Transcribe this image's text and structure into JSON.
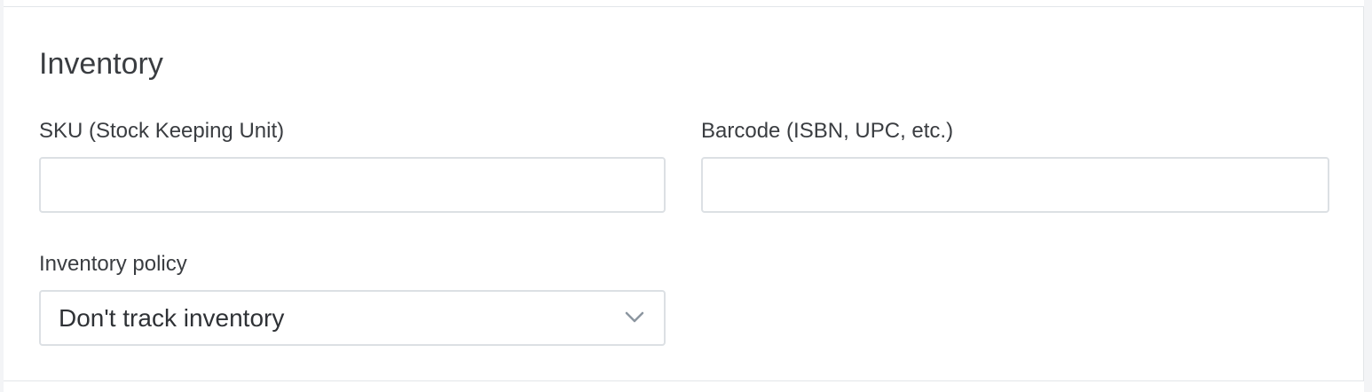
{
  "section": {
    "title": "Inventory"
  },
  "fields": {
    "sku": {
      "label": "SKU (Stock Keeping Unit)",
      "value": "",
      "placeholder": ""
    },
    "barcode": {
      "label": "Barcode (ISBN, UPC, etc.)",
      "value": "",
      "placeholder": ""
    },
    "policy": {
      "label": "Inventory policy",
      "selected": "Don't track inventory",
      "icon": "chevron-down-icon"
    }
  },
  "colors": {
    "text": "#3a3d41",
    "border": "#dce0e4",
    "chevron": "#8c96a0"
  }
}
